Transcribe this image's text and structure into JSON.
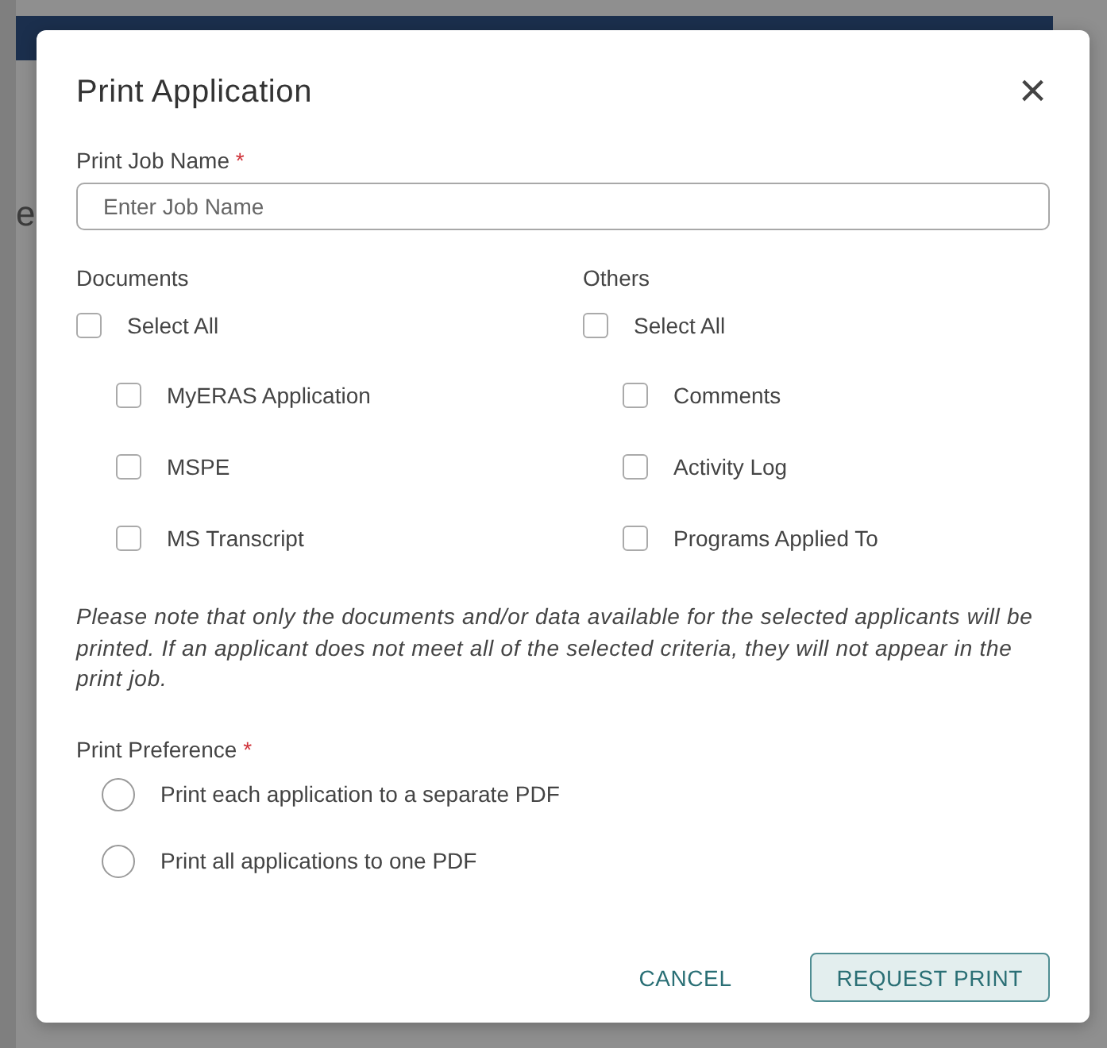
{
  "background": {
    "heading": "e"
  },
  "dialog": {
    "title": "Print Application",
    "close": "×",
    "job_name": {
      "label": "Print Job Name",
      "required_mark": "*",
      "placeholder": "Enter Job Name"
    },
    "groups": [
      {
        "title": "Documents",
        "select_all": {
          "label": "Select All",
          "checked": false
        },
        "items": [
          {
            "label": "MyERAS Application",
            "checked": false
          },
          {
            "label": "MSPE",
            "checked": false
          },
          {
            "label": "MS Transcript",
            "checked": false
          }
        ]
      },
      {
        "title": "Others",
        "select_all": {
          "label": "Select All",
          "checked": false
        },
        "items": [
          {
            "label": "Comments",
            "checked": false
          },
          {
            "label": "Activity Log",
            "checked": false
          },
          {
            "label": "Programs Applied To",
            "checked": false
          }
        ]
      }
    ],
    "note": "Please note that only the documents and/or data available for the selected applicants will be printed. If an applicant does not meet all of the selected criteria, they will not appear in the print job.",
    "preference": {
      "label": "Print Preference",
      "required_mark": "*",
      "options": [
        {
          "label": "Print each application to a separate PDF",
          "selected": false
        },
        {
          "label": "Print all applications to one PDF",
          "selected": false
        }
      ]
    },
    "buttons": [
      {
        "label": "CANCEL",
        "kind": "text"
      },
      {
        "label": "REQUEST PRINT",
        "kind": "outlined"
      }
    ]
  }
}
